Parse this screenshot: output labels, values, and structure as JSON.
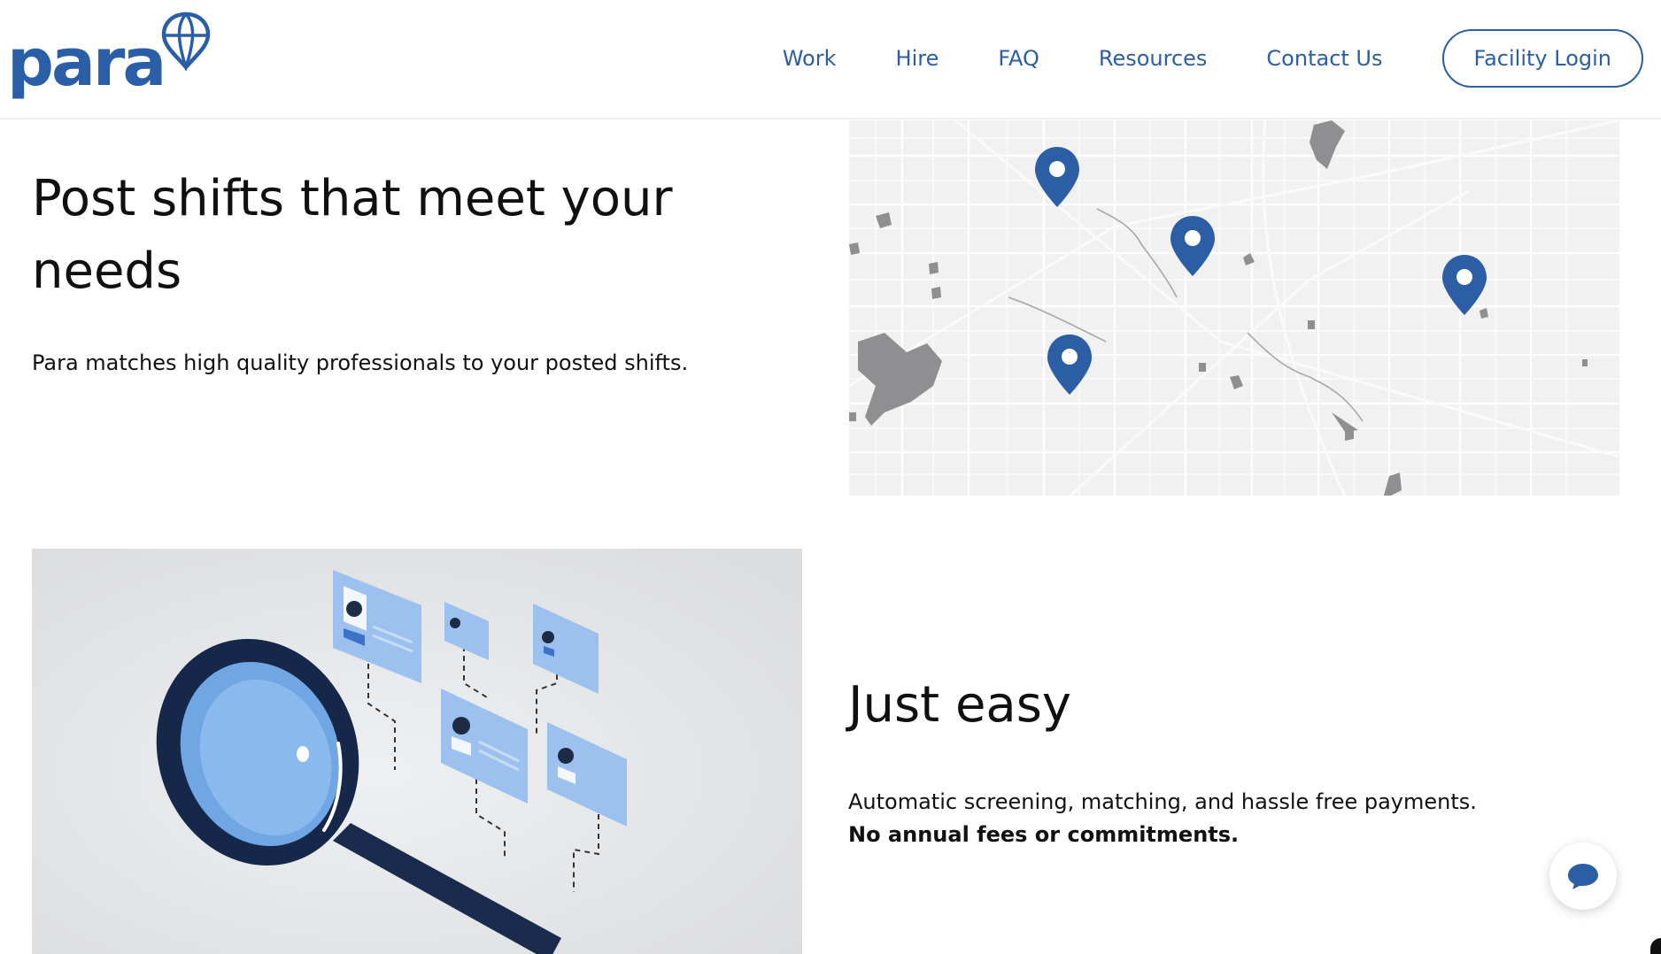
{
  "brand": {
    "name": "para",
    "color": "#2a5ea6"
  },
  "nav": {
    "items": [
      {
        "label": "Work"
      },
      {
        "label": "Hire"
      },
      {
        "label": "FAQ"
      },
      {
        "label": "Resources"
      },
      {
        "label": "Contact Us"
      }
    ],
    "login_label": "Facility Login"
  },
  "section1": {
    "headline": "Post shifts that meet your needs",
    "subtext": "Para matches high quality professionals to your posted shifts.",
    "image": {
      "icon": "map-with-location-pins",
      "pin_color": "#2b5ea4"
    }
  },
  "section2": {
    "headline": "Just easy",
    "subtext": "Automatic screening, matching, and hassle free payments.",
    "subtext_bold": "No annual fees or commitments.",
    "image": {
      "icon": "magnifying-glass-profile-cards"
    }
  },
  "chat": {
    "icon": "chat-bubble-icon"
  }
}
